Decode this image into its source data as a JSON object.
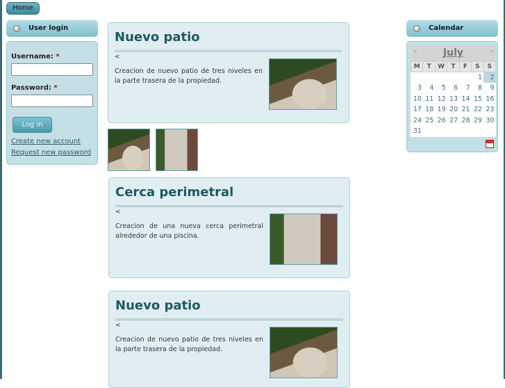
{
  "nav": {
    "home": "Home"
  },
  "login": {
    "title": "User login",
    "username_label": "Username:",
    "password_label": "Password:",
    "required": "*",
    "username_value": "",
    "password_value": "",
    "submit": "Log in",
    "create": "Create new account",
    "request": "Request new password"
  },
  "nodes": [
    {
      "title": "Nouvo patio",
      "back": "<",
      "body": "Creacion de nuevo patio de tres niveles en la parte trasera de la propiedad."
    },
    {
      "title": "Cerca perimetral",
      "back": "<",
      "body": "Creacion de una nueva cerca perimetral alrededor de una piscina."
    },
    {
      "title": "Nuevo patio",
      "back": "<",
      "body": "Creacion de nuevo patio de tres niveles en la parte trasera de la propiedad."
    }
  ],
  "calendar": {
    "title": "Calendar",
    "month": "July",
    "prev": "«",
    "next": "»",
    "days": [
      "M",
      "T",
      "W",
      "T",
      "F",
      "S",
      "S"
    ],
    "weeks": [
      [
        "",
        "",
        "",
        "",
        "",
        "1",
        "2"
      ],
      [
        "3",
        "4",
        "5",
        "6",
        "7",
        "8",
        "9"
      ],
      [
        "10",
        "11",
        "12",
        "13",
        "14",
        "15",
        "16"
      ],
      [
        "17",
        "18",
        "19",
        "20",
        "21",
        "22",
        "23"
      ],
      [
        "24",
        "25",
        "26",
        "27",
        "28",
        "29",
        "30"
      ],
      [
        "31",
        "",
        "",
        "",
        "",
        "",
        ""
      ]
    ],
    "today": "2"
  }
}
